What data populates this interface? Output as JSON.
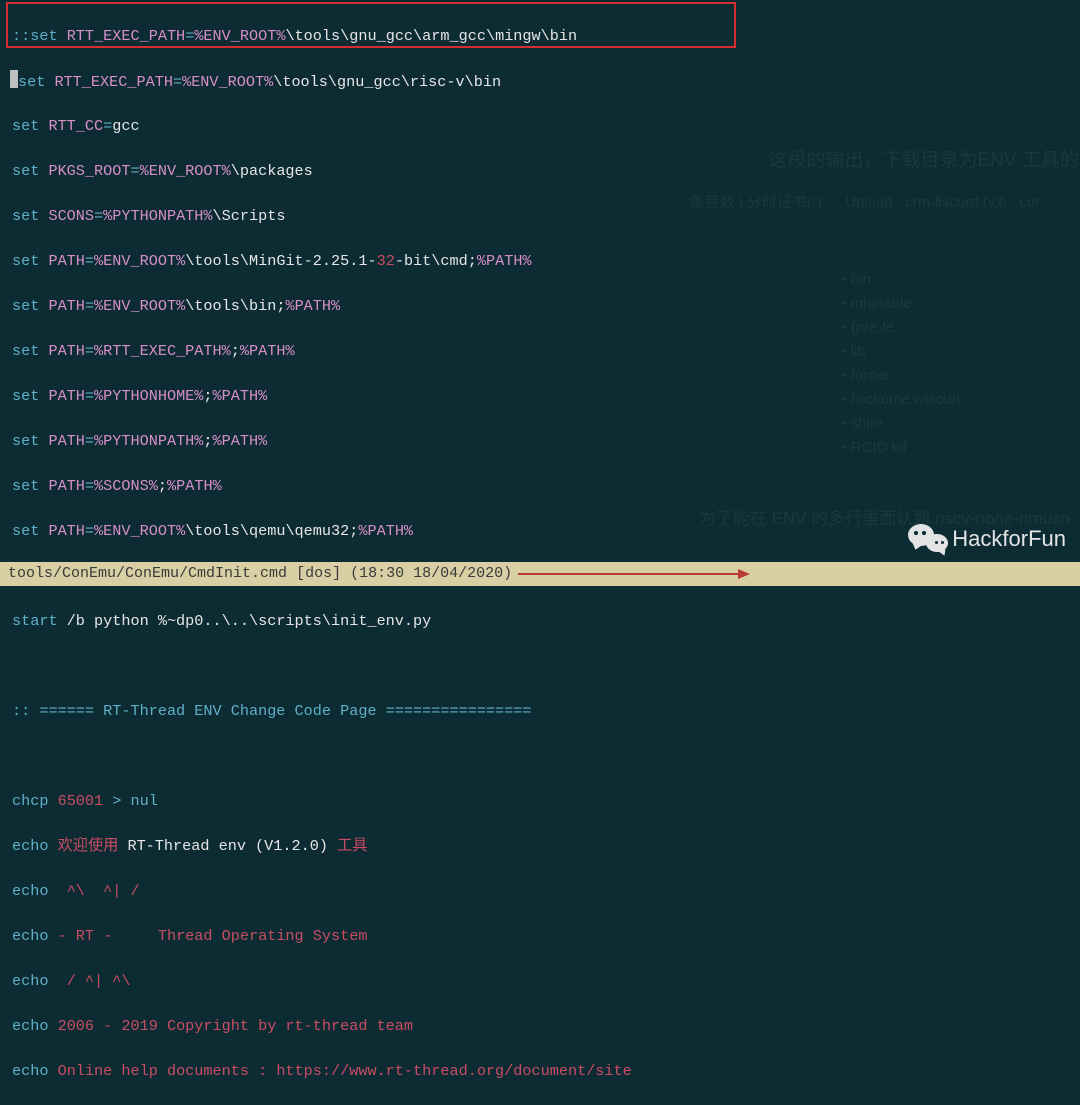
{
  "lines": {
    "l1_pre": "::",
    "l1_set": "set",
    "l1_var": " RTT_EXEC_PATH",
    "l1_eq": "=",
    "l1_env": "%ENV_ROOT%",
    "l1_path": "\\tools\\gnu_gcc\\arm_gcc\\mingw\\bin",
    "l2_set": "set",
    "l2_var": " RTT_EXEC_PATH",
    "l2_eq": "=",
    "l2_env": "%ENV_ROOT%",
    "l2_path": "\\tools\\gnu_gcc\\risc-v\\bin",
    "l3_set": "set",
    "l3_var": " RTT_CC",
    "l3_eq": "=",
    "l3_val": "gcc",
    "l4_set": "set",
    "l4_var": " PKGS_ROOT",
    "l4_eq": "=",
    "l4_env": "%ENV_ROOT%",
    "l4_path": "\\packages",
    "l5_set": "set",
    "l5_var": " SCONS",
    "l5_eq": "=",
    "l5_env": "%PYTHONPATH%",
    "l5_path": "\\Scripts",
    "l6_set": "set",
    "l6_var": " PATH",
    "l6_eq": "=",
    "l6_env": "%ENV_ROOT%",
    "l6_mid": "\\tools\\MinGit-2.25.1-",
    "l6_num": "32",
    "l6_tail1": "-bit\\cmd;",
    "l6_env2": "%PATH%",
    "l7_set": "set",
    "l7_var": " PATH",
    "l7_eq": "=",
    "l7_env": "%ENV_ROOT%",
    "l7_mid": "\\tools\\bin;",
    "l7_env2": "%PATH%",
    "l8_set": "set",
    "l8_var": " PATH",
    "l8_eq": "=",
    "l8_env": "%RTT_EXEC_PATH%",
    "l8_semi": ";",
    "l8_env2": "%PATH%",
    "l9_set": "set",
    "l9_var": " PATH",
    "l9_eq": "=",
    "l9_env": "%PYTHONHOME%",
    "l9_semi": ";",
    "l9_env2": "%PATH%",
    "l10_set": "set",
    "l10_var": " PATH",
    "l10_eq": "=",
    "l10_env": "%PYTHONPATH%",
    "l10_semi": ";",
    "l10_env2": "%PATH%",
    "l11_set": "set",
    "l11_var": " PATH",
    "l11_eq": "=",
    "l11_env": "%SCONS%",
    "l11_semi": ";",
    "l11_env2": "%PATH%",
    "l12_set": "set",
    "l12_var": " PATH",
    "l12_eq": "=",
    "l12_env": "%ENV_ROOT%",
    "l12_mid": "\\tools\\qemu\\qemu32;",
    "l12_env2": "%PATH%",
    "l13_start": "start",
    "l13_rest": " /b python %~dp0..\\..\\scripts\\init_env.py",
    "l14": ":: ====== RT-Thread ENV Change Code Page ================",
    "l15_cmd": "chcp",
    "l15_num": " 65001",
    "l15_op": " > ",
    "l15_nul": "nul",
    "l16_cmd": "echo",
    "l16_zh": " 欢迎使用",
    "l16_rest": " RT-Thread env (V1.2.0)",
    "l16_zh2": " 工具",
    "l17_cmd": "echo",
    "l17_rest": "  ^\\  ^| /",
    "l18_cmd": "echo",
    "l18_rest": " - RT -     Thread Operating System",
    "l19_cmd": "echo",
    "l19_rest": "  / ^| ^\\",
    "l20_cmd": "echo",
    "l20_rest": " 2006 - 2019 Copyright by rt-thread team",
    "l21_cmd": "echo",
    "l21_rest": " Online help documents : https://www.rt-thread.org/document/site"
  },
  "status": {
    "path": "tools/ConEmu/ConEmu/CmdInit.cmd",
    "filetype": "[dos]",
    "time": "(18:30 18/04/2020)"
  },
  "watermark": {
    "text": "HackforFun"
  },
  "ghost": {
    "g1": "这段的输出，下载目录为ENV 工具的 /tool",
    "g2": "条目数 | 分时证书(r) … Upload : crm-liscurd (v,b : cur",
    "list1": "• bin",
    "list2": "• mhinable",
    "list3": "• (pre,fe",
    "list4": "• lib",
    "list5": "• forner",
    "list6": "• fxickome wiscurl",
    "list7": "• shire",
    "list8": "• RCID kif",
    "g3": "为了能在 ENV 的多行里面认到 riscv-none-nmuzo"
  }
}
